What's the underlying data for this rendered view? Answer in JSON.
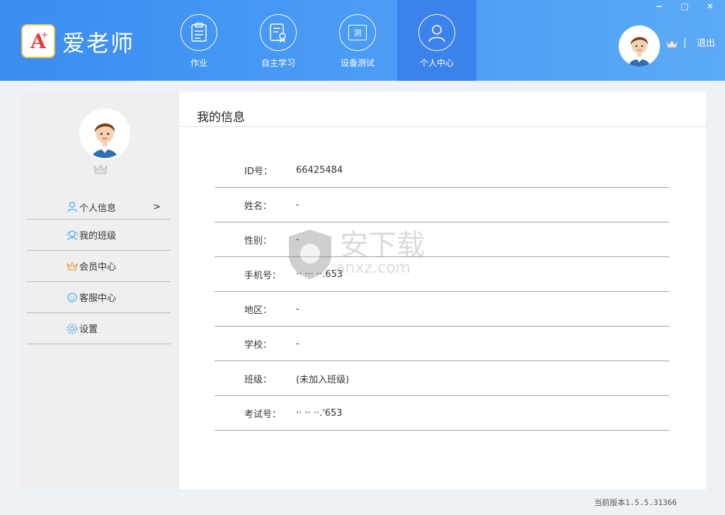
{
  "app": {
    "title": "爱老师",
    "logo_letter": "A",
    "logo_mark": "+"
  },
  "nav": {
    "items": [
      {
        "label": "作业",
        "icon": "clipboard-icon"
      },
      {
        "label": "自主学习",
        "icon": "study-certificate-icon"
      },
      {
        "label": "设备测试",
        "icon": "device-test-icon",
        "glyph": "测"
      },
      {
        "label": "个人中心",
        "icon": "user-icon"
      }
    ],
    "active_index": 3
  },
  "window_controls": {
    "minimize": "−",
    "maximize": "□",
    "close": "✕"
  },
  "header_user": {
    "separator": "|",
    "logout_label": "退出"
  },
  "sidebar": {
    "menu": [
      {
        "label": "个人信息",
        "icon": "person-icon",
        "chevron": ">"
      },
      {
        "label": "我的班级",
        "icon": "class-group-icon"
      },
      {
        "label": "会员中心",
        "icon": "crown-icon"
      },
      {
        "label": "客服中心",
        "icon": "support-smile-icon"
      },
      {
        "label": "设置",
        "icon": "settings-gear-icon"
      }
    ]
  },
  "content": {
    "title": "我的信息",
    "fields": [
      {
        "label": "ID号：",
        "value": "66425484"
      },
      {
        "label": "姓名：",
        "value": "-"
      },
      {
        "label": "性别：",
        "value": "-"
      },
      {
        "label": "手机号：",
        "value": "·· ··· ··.653"
      },
      {
        "label": "地区：",
        "value": "-"
      },
      {
        "label": "学校：",
        "value": "-"
      },
      {
        "label": "班级：",
        "value": "(未加入班级)"
      },
      {
        "label": "考试号：",
        "value": "·· ·· ··.'653"
      }
    ]
  },
  "footer": {
    "version": "当前版本1.5.5.31366"
  },
  "watermark": {
    "text": "安下载",
    "sub": "anxz.com"
  },
  "colors": {
    "header_start": "#3a8df0",
    "header_end": "#5aaaf6",
    "active_nav": "#3b82ea",
    "sidebar_bg": "#f0eef0",
    "menu_icon_blue": "#3fb0e8",
    "crown_orange": "#f0a030"
  }
}
